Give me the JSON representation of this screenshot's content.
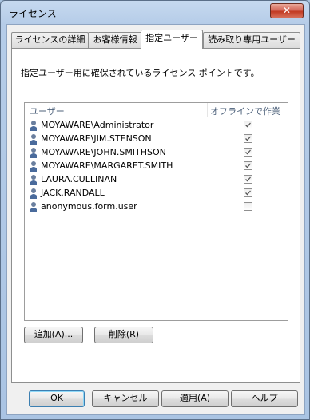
{
  "window": {
    "title": "ライセンス",
    "close_glyph": "✕"
  },
  "tabs": [
    {
      "label": "ライセンスの詳細",
      "active": false
    },
    {
      "label": "お客様情報",
      "active": false
    },
    {
      "label": "指定ユーザー",
      "active": true
    },
    {
      "label": "読み取り専用ユーザー",
      "active": false
    }
  ],
  "panel": {
    "description": "指定ユーザー用に確保されているライセンス ポイントです。",
    "list": {
      "columns": [
        "ユーザー",
        "オフラインで作業"
      ],
      "rows": [
        {
          "user": "MOYAWARE\\Administrator",
          "offline": true
        },
        {
          "user": "MOYAWARE\\JIM.STENSON",
          "offline": true
        },
        {
          "user": "MOYAWARE\\JOHN.SMITHSON",
          "offline": true
        },
        {
          "user": "MOYAWARE\\MARGARET.SMITH",
          "offline": true
        },
        {
          "user": "LAURA.CULLINAN",
          "offline": true
        },
        {
          "user": "JACK.RANDALL",
          "offline": true
        },
        {
          "user": "anonymous.form.user",
          "offline": false
        }
      ]
    },
    "buttons": {
      "add": "追加(A)...",
      "remove": "削除(R)"
    }
  },
  "footer": {
    "ok": "OK",
    "cancel": "キャンセル",
    "apply": "適用(A)",
    "help": "ヘルプ"
  },
  "colors": {
    "accent": "#3c7fb1",
    "titlebar": "#b5cce8",
    "close": "#c23a22"
  },
  "icons": {
    "user": "user-icon",
    "close": "close-icon",
    "check": "checkmark-icon"
  }
}
